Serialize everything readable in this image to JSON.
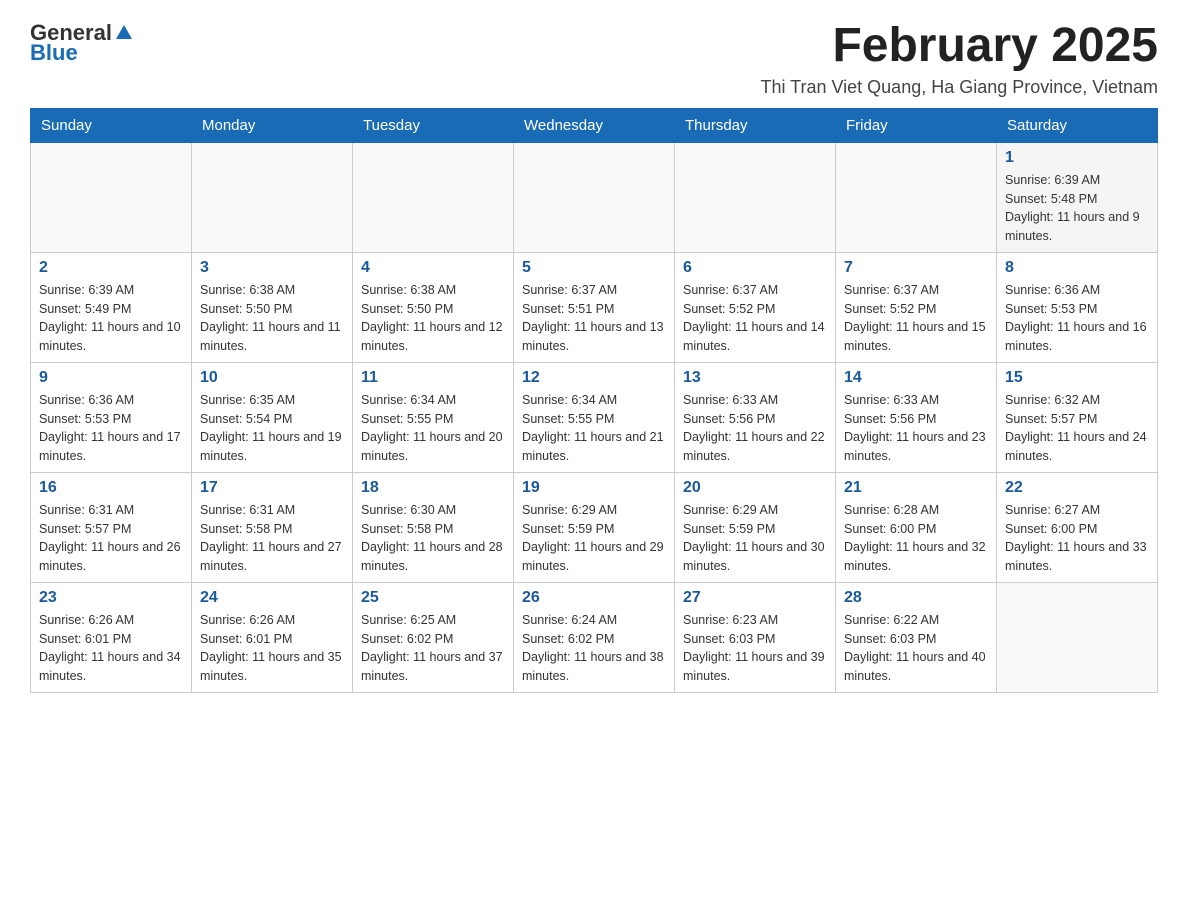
{
  "logo": {
    "text_general": "General",
    "text_blue": "Blue"
  },
  "title": "February 2025",
  "subtitle": "Thi Tran Viet Quang, Ha Giang Province, Vietnam",
  "days_of_week": [
    "Sunday",
    "Monday",
    "Tuesday",
    "Wednesday",
    "Thursday",
    "Friday",
    "Saturday"
  ],
  "weeks": [
    [
      {
        "day": "",
        "info": ""
      },
      {
        "day": "",
        "info": ""
      },
      {
        "day": "",
        "info": ""
      },
      {
        "day": "",
        "info": ""
      },
      {
        "day": "",
        "info": ""
      },
      {
        "day": "",
        "info": ""
      },
      {
        "day": "1",
        "info": "Sunrise: 6:39 AM\nSunset: 5:48 PM\nDaylight: 11 hours and 9 minutes."
      }
    ],
    [
      {
        "day": "2",
        "info": "Sunrise: 6:39 AM\nSunset: 5:49 PM\nDaylight: 11 hours and 10 minutes."
      },
      {
        "day": "3",
        "info": "Sunrise: 6:38 AM\nSunset: 5:50 PM\nDaylight: 11 hours and 11 minutes."
      },
      {
        "day": "4",
        "info": "Sunrise: 6:38 AM\nSunset: 5:50 PM\nDaylight: 11 hours and 12 minutes."
      },
      {
        "day": "5",
        "info": "Sunrise: 6:37 AM\nSunset: 5:51 PM\nDaylight: 11 hours and 13 minutes."
      },
      {
        "day": "6",
        "info": "Sunrise: 6:37 AM\nSunset: 5:52 PM\nDaylight: 11 hours and 14 minutes."
      },
      {
        "day": "7",
        "info": "Sunrise: 6:37 AM\nSunset: 5:52 PM\nDaylight: 11 hours and 15 minutes."
      },
      {
        "day": "8",
        "info": "Sunrise: 6:36 AM\nSunset: 5:53 PM\nDaylight: 11 hours and 16 minutes."
      }
    ],
    [
      {
        "day": "9",
        "info": "Sunrise: 6:36 AM\nSunset: 5:53 PM\nDaylight: 11 hours and 17 minutes."
      },
      {
        "day": "10",
        "info": "Sunrise: 6:35 AM\nSunset: 5:54 PM\nDaylight: 11 hours and 19 minutes."
      },
      {
        "day": "11",
        "info": "Sunrise: 6:34 AM\nSunset: 5:55 PM\nDaylight: 11 hours and 20 minutes."
      },
      {
        "day": "12",
        "info": "Sunrise: 6:34 AM\nSunset: 5:55 PM\nDaylight: 11 hours and 21 minutes."
      },
      {
        "day": "13",
        "info": "Sunrise: 6:33 AM\nSunset: 5:56 PM\nDaylight: 11 hours and 22 minutes."
      },
      {
        "day": "14",
        "info": "Sunrise: 6:33 AM\nSunset: 5:56 PM\nDaylight: 11 hours and 23 minutes."
      },
      {
        "day": "15",
        "info": "Sunrise: 6:32 AM\nSunset: 5:57 PM\nDaylight: 11 hours and 24 minutes."
      }
    ],
    [
      {
        "day": "16",
        "info": "Sunrise: 6:31 AM\nSunset: 5:57 PM\nDaylight: 11 hours and 26 minutes."
      },
      {
        "day": "17",
        "info": "Sunrise: 6:31 AM\nSunset: 5:58 PM\nDaylight: 11 hours and 27 minutes."
      },
      {
        "day": "18",
        "info": "Sunrise: 6:30 AM\nSunset: 5:58 PM\nDaylight: 11 hours and 28 minutes."
      },
      {
        "day": "19",
        "info": "Sunrise: 6:29 AM\nSunset: 5:59 PM\nDaylight: 11 hours and 29 minutes."
      },
      {
        "day": "20",
        "info": "Sunrise: 6:29 AM\nSunset: 5:59 PM\nDaylight: 11 hours and 30 minutes."
      },
      {
        "day": "21",
        "info": "Sunrise: 6:28 AM\nSunset: 6:00 PM\nDaylight: 11 hours and 32 minutes."
      },
      {
        "day": "22",
        "info": "Sunrise: 6:27 AM\nSunset: 6:00 PM\nDaylight: 11 hours and 33 minutes."
      }
    ],
    [
      {
        "day": "23",
        "info": "Sunrise: 6:26 AM\nSunset: 6:01 PM\nDaylight: 11 hours and 34 minutes."
      },
      {
        "day": "24",
        "info": "Sunrise: 6:26 AM\nSunset: 6:01 PM\nDaylight: 11 hours and 35 minutes."
      },
      {
        "day": "25",
        "info": "Sunrise: 6:25 AM\nSunset: 6:02 PM\nDaylight: 11 hours and 37 minutes."
      },
      {
        "day": "26",
        "info": "Sunrise: 6:24 AM\nSunset: 6:02 PM\nDaylight: 11 hours and 38 minutes."
      },
      {
        "day": "27",
        "info": "Sunrise: 6:23 AM\nSunset: 6:03 PM\nDaylight: 11 hours and 39 minutes."
      },
      {
        "day": "28",
        "info": "Sunrise: 6:22 AM\nSunset: 6:03 PM\nDaylight: 11 hours and 40 minutes."
      },
      {
        "day": "",
        "info": ""
      }
    ]
  ]
}
